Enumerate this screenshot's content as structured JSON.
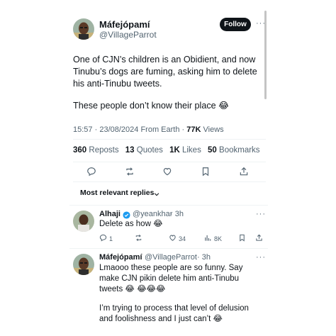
{
  "tweet": {
    "author_name": "Máfejópamí",
    "author_handle": "@VillageParrot",
    "follow_label": "Follow",
    "more_label": "···",
    "paragraph1": "One of CJN’s children is an Obidient, and now Tinubu’s dogs are fuming, asking him to delete his anti-Tinubu tweets.",
    "paragraph2": "These people don’t know their place 😂",
    "time": "15:57",
    "date": "23/08/2024",
    "source": "From Earth",
    "views_count": "77K",
    "views_label": "Views",
    "sep": "·"
  },
  "stats": {
    "reposts_count": "360",
    "reposts_label": "Reposts",
    "quotes_count": "13",
    "quotes_label": "Quotes",
    "likes_count": "1K",
    "likes_label": "Likes",
    "bookmarks_count": "50",
    "bookmarks_label": "Bookmarks"
  },
  "sort": {
    "label": "Most relevant replies"
  },
  "replies": [
    {
      "name": "Alhaji",
      "verified": true,
      "handle": "@yeankhar",
      "time": "· 3h",
      "text": "Delete as how 😂",
      "replies_count": "1",
      "likes_count": "34",
      "views_count": "8K"
    },
    {
      "name": "Máfejópamí",
      "handle": "@VillageParrot",
      "time": "· 3h",
      "text1": "Lmaooo these people are so funny. Say make CJN pikin delete him anti-Tinubu tweets 😂 😂😂😂",
      "text2": "I’m trying to process that level of delusion and foolishness and I just can’t 😂"
    }
  ],
  "colors": {
    "verified": "#1d9bf0",
    "muted": "#536471",
    "text": "#0f1419"
  }
}
